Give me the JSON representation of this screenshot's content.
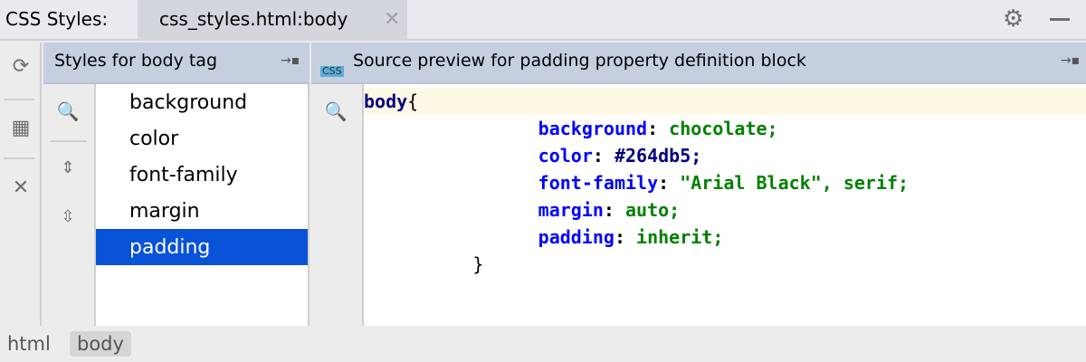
{
  "header": {
    "title": "CSS Styles:",
    "tab": "css_styles.html:body"
  },
  "left_panel": {
    "title": "Styles for body tag",
    "properties": [
      "background",
      "color",
      "font-family",
      "margin",
      "padding"
    ],
    "selected": "padding"
  },
  "right_panel": {
    "title": "Source preview for padding property definition block",
    "css_badge": "CSS"
  },
  "code": {
    "selector": "body",
    "open": "{",
    "close": "}",
    "rules": [
      {
        "prop": "background",
        "value": "chocolate;"
      },
      {
        "prop": "color",
        "value": "#264db5;"
      },
      {
        "prop": "font-family",
        "value": "\"Arial Black\", serif;"
      },
      {
        "prop": "margin",
        "value": "auto;"
      },
      {
        "prop": "padding",
        "value": "inherit;"
      }
    ]
  },
  "breadcrumbs": [
    "html",
    "body"
  ],
  "colors": {
    "selection": "#0852d8",
    "header": "#c5cfe0",
    "highlight": "#fef9e4"
  }
}
